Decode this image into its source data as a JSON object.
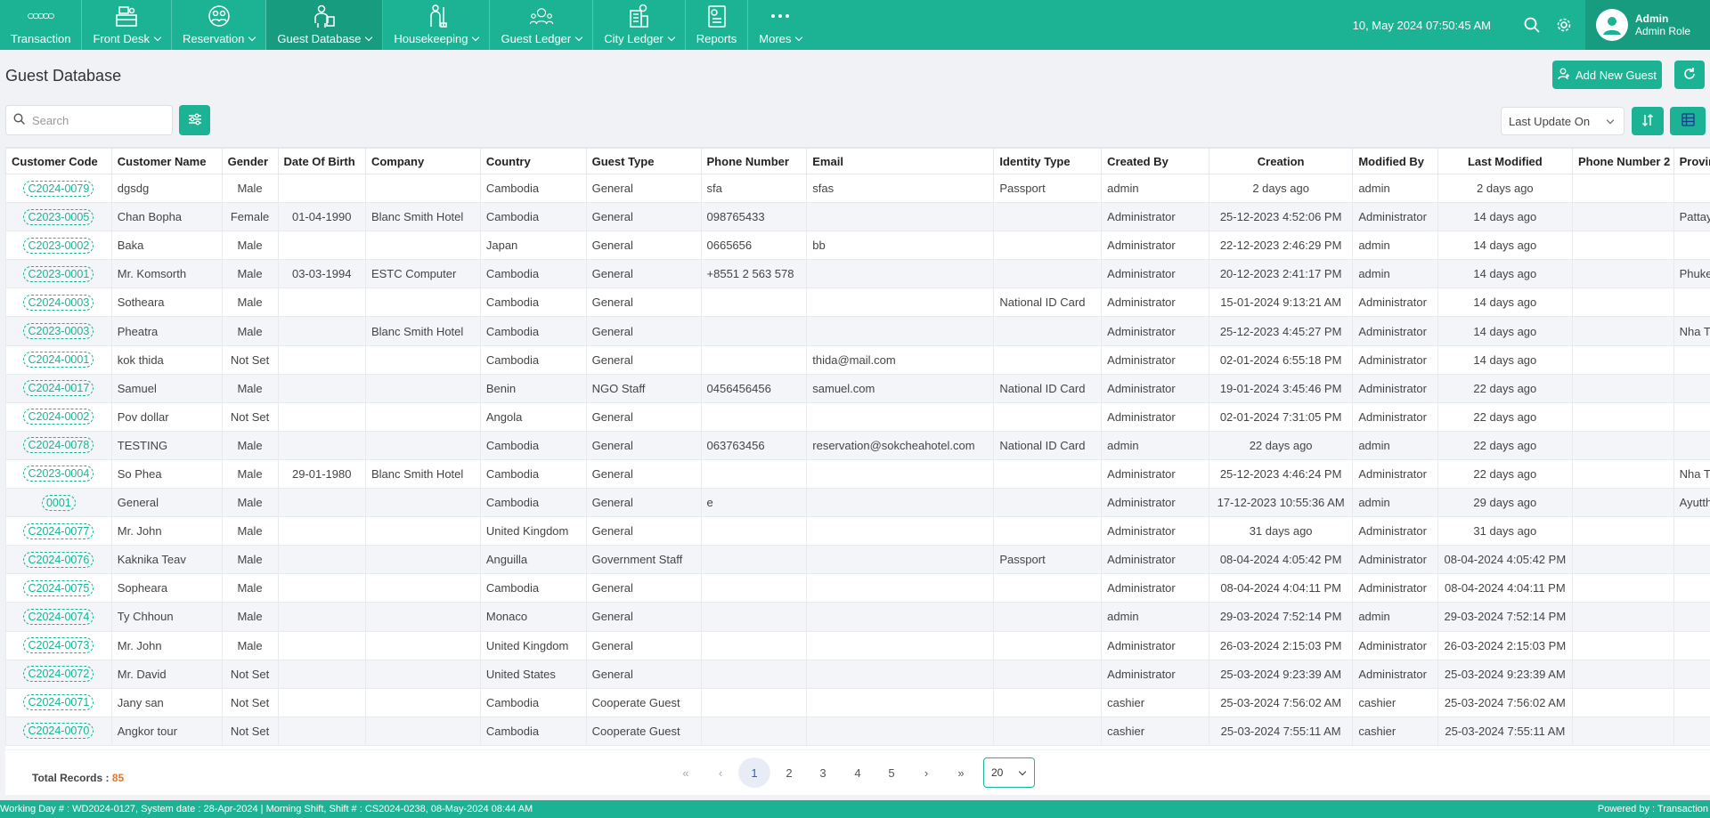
{
  "nav": {
    "items": [
      {
        "label": "Transaction",
        "icon": "rings-icon",
        "dropdown": false
      },
      {
        "label": "Front Desk",
        "icon": "front-desk-icon",
        "dropdown": true
      },
      {
        "label": "Reservation",
        "icon": "reservation-icon",
        "dropdown": true
      },
      {
        "label": "Guest Database",
        "icon": "guest-database-icon",
        "dropdown": true,
        "active": true
      },
      {
        "label": "Housekeeping",
        "icon": "housekeeping-icon",
        "dropdown": true
      },
      {
        "label": "Guest Ledger",
        "icon": "guest-ledger-icon",
        "dropdown": true
      },
      {
        "label": "City Ledger",
        "icon": "city-ledger-icon",
        "dropdown": true
      },
      {
        "label": "Reports",
        "icon": "reports-icon",
        "dropdown": false
      },
      {
        "label": "Mores",
        "icon": "more-dots-icon",
        "dropdown": true
      }
    ],
    "datetime": "10, May 2024 07:50:45 AM",
    "user_name": "Admin",
    "user_role": "Admin Role"
  },
  "page": {
    "title": "Guest Database",
    "add_button": "Add New Guest",
    "search_placeholder": "Search",
    "sort_by": "Last Update On"
  },
  "table": {
    "columns": [
      "Customer Code",
      "Customer Name",
      "Gender",
      "Date Of Birth",
      "Company",
      "Country",
      "Guest Type",
      "Phone Number",
      "Email",
      "Identity Type",
      "Created By",
      "Creation",
      "Modified By",
      "Last Modified",
      "Phone Number 2",
      "Province"
    ],
    "rows": [
      [
        "C2024-0079",
        "dgsdg",
        "Male",
        "",
        "",
        "Cambodia",
        "General",
        "sfa",
        "sfas",
        "Passport",
        "admin",
        "2 days ago",
        "admin",
        "2 days ago",
        "",
        ""
      ],
      [
        "C2023-0005",
        "Chan Bopha",
        "Female",
        "01-04-1990",
        "Blanc Smith Hotel",
        "Cambodia",
        "General",
        "098765433",
        "",
        "",
        "Administrator",
        "25-12-2023 4:52:06 PM",
        "Administrator",
        "14 days ago",
        "",
        "Pattaya"
      ],
      [
        "C2023-0002",
        "Baka",
        "Male",
        "",
        "",
        "Japan",
        "General",
        "0665656",
        "bb",
        "",
        "Administrator",
        "22-12-2023 2:46:29 PM",
        "admin",
        "14 days ago",
        "",
        ""
      ],
      [
        "C2023-0001",
        "Mr. Komsorth",
        "Male",
        "03-03-1994",
        "ESTC Computer",
        "Cambodia",
        "General",
        "+8551 2 563 578",
        "",
        "",
        "Administrator",
        "20-12-2023 2:41:17 PM",
        "admin",
        "14 days ago",
        "",
        "Phuket"
      ],
      [
        "C2024-0003",
        "Sotheara",
        "Male",
        "",
        "",
        "Cambodia",
        "General",
        "",
        "",
        "National ID Card",
        "Administrator",
        "15-01-2024 9:13:21 AM",
        "Administrator",
        "14 days ago",
        "",
        ""
      ],
      [
        "C2023-0003",
        "Pheatra",
        "Male",
        "",
        "Blanc Smith Hotel",
        "Cambodia",
        "General",
        "",
        "",
        "",
        "Administrator",
        "25-12-2023 4:45:27 PM",
        "Administrator",
        "14 days ago",
        "",
        "Nha Trang"
      ],
      [
        "C2024-0001",
        "kok thida",
        "Not Set",
        "",
        "",
        "Cambodia",
        "General",
        "",
        "thida@mail.com",
        "",
        "Administrator",
        "02-01-2024 6:55:18 PM",
        "Administrator",
        "14 days ago",
        "",
        ""
      ],
      [
        "C2024-0017",
        "Samuel",
        "Male",
        "",
        "",
        "Benin",
        "NGO Staff",
        "0456456456",
        "samuel.com",
        "National ID Card",
        "Administrator",
        "19-01-2024 3:45:46 PM",
        "Administrator",
        "22 days ago",
        "",
        ""
      ],
      [
        "C2024-0002",
        "Pov dollar",
        "Not Set",
        "",
        "",
        "Angola",
        "General",
        "",
        "",
        "",
        "Administrator",
        "02-01-2024 7:31:05 PM",
        "Administrator",
        "22 days ago",
        "",
        ""
      ],
      [
        "C2024-0078",
        "TESTING",
        "Male",
        "",
        "",
        "Cambodia",
        "General",
        "063763456",
        "reservation@sokcheahotel.com",
        "National ID Card",
        "admin",
        "22 days ago",
        "admin",
        "22 days ago",
        "",
        ""
      ],
      [
        "C2023-0004",
        "So Phea",
        "Male",
        "29-01-1980",
        "Blanc Smith Hotel",
        "Cambodia",
        "General",
        "",
        "",
        "",
        "Administrator",
        "25-12-2023 4:46:24 PM",
        "Administrator",
        "22 days ago",
        "",
        "Nha Trang"
      ],
      [
        "0001",
        "General",
        "Male",
        "",
        "",
        "Cambodia",
        "General",
        "e",
        "",
        "",
        "Administrator",
        "17-12-2023 10:55:36 AM",
        "admin",
        "29 days ago",
        "",
        "Ayutthaya"
      ],
      [
        "C2024-0077",
        "Mr. John",
        "Male",
        "",
        "",
        "United Kingdom",
        "General",
        "",
        "",
        "",
        "Administrator",
        "31 days ago",
        "Administrator",
        "31 days ago",
        "",
        ""
      ],
      [
        "C2024-0076",
        "Kaknika Teav",
        "Male",
        "",
        "",
        "Anguilla",
        "Government Staff",
        "",
        "",
        "Passport",
        "Administrator",
        "08-04-2024 4:05:42 PM",
        "Administrator",
        "08-04-2024 4:05:42 PM",
        "",
        ""
      ],
      [
        "C2024-0075",
        "Sopheara",
        "Male",
        "",
        "",
        "Cambodia",
        "General",
        "",
        "",
        "",
        "Administrator",
        "08-04-2024 4:04:11 PM",
        "Administrator",
        "08-04-2024 4:04:11 PM",
        "",
        ""
      ],
      [
        "C2024-0074",
        "Ty Chhoun",
        "Male",
        "",
        "",
        "Monaco",
        "General",
        "",
        "",
        "",
        "admin",
        "29-03-2024 7:52:14 PM",
        "admin",
        "29-03-2024 7:52:14 PM",
        "",
        ""
      ],
      [
        "C2024-0073",
        "Mr. John",
        "Male",
        "",
        "",
        "United Kingdom",
        "General",
        "",
        "",
        "",
        "Administrator",
        "26-03-2024 2:15:03 PM",
        "Administrator",
        "26-03-2024 2:15:03 PM",
        "",
        ""
      ],
      [
        "C2024-0072",
        "Mr. David",
        "Not Set",
        "",
        "",
        "United States",
        "General",
        "",
        "",
        "",
        "Administrator",
        "25-03-2024 9:23:39 AM",
        "Administrator",
        "25-03-2024 9:23:39 AM",
        "",
        ""
      ],
      [
        "C2024-0071",
        "Jany san",
        "Not Set",
        "",
        "",
        "Cambodia",
        "Cooperate Guest",
        "",
        "",
        "",
        "cashier",
        "25-03-2024 7:56:02 AM",
        "cashier",
        "25-03-2024 7:56:02 AM",
        "",
        ""
      ],
      [
        "C2024-0070",
        "Angkor tour",
        "Not Set",
        "",
        "",
        "Cambodia",
        "Cooperate Guest",
        "",
        "",
        "",
        "cashier",
        "25-03-2024 7:55:11 AM",
        "cashier",
        "25-03-2024 7:55:11 AM",
        "",
        ""
      ]
    ]
  },
  "pager": {
    "total_label": "Total Records :",
    "total": "85",
    "first": "«",
    "prev": "‹",
    "pages": [
      "1",
      "2",
      "3",
      "4",
      "5"
    ],
    "current": "1",
    "next": "›",
    "last": "»",
    "page_size": "20"
  },
  "status": {
    "left": "Working Day # : WD2024-0127, System date : 28-Apr-2024 | Morning Shift, Shift # : CS2024-0238, 08-May-2024 08:44 AM",
    "right": "Powered by : Transaction"
  },
  "colors": {
    "accent": "#1cb394",
    "accent_dark": "#179c80",
    "total_count": "#e8742a"
  }
}
